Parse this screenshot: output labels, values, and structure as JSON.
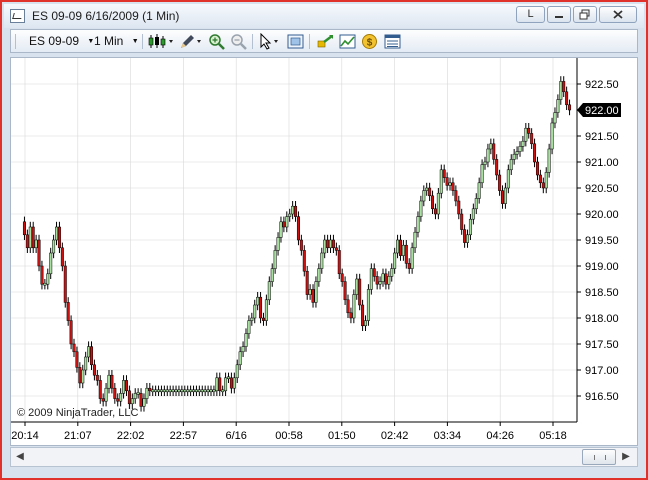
{
  "window": {
    "title": "ES 09-09  6/16/2009 (1 Min)",
    "btn_l": "L"
  },
  "toolbar": {
    "instrument": "ES 09-09",
    "interval": "1 Min",
    "dropdown_glyph": "▼"
  },
  "chart": {
    "copyright": "© 2009 NinjaTrader, LLC",
    "last_price_label": "922.00",
    "colors": {
      "up": "#a8e0a0",
      "down": "#cc1111",
      "wick": "#000000",
      "grid": "#d8d8d8"
    }
  },
  "chart_data": {
    "type": "ohlc-candlestick",
    "instrument": "ES 09-09",
    "interval": "1 Min",
    "ylim": [
      916.25,
      922.75
    ],
    "y_ticks": [
      "922.50",
      "922.00",
      "921.50",
      "921.00",
      "920.50",
      "920.00",
      "919.50",
      "919.00",
      "918.50",
      "918.00",
      "917.50",
      "917.00",
      "916.50"
    ],
    "x_ticks": [
      "20:14",
      "21:07",
      "22:02",
      "22:57",
      "6/16",
      "00:58",
      "01:50",
      "02:42",
      "03:34",
      "04:26",
      "05:18"
    ],
    "last_price": 922.0,
    "closes": [
      919.6,
      919.35,
      919.75,
      919.35,
      919.5,
      919.0,
      918.65,
      918.65,
      918.85,
      919.25,
      919.5,
      919.75,
      919.35,
      919.0,
      918.3,
      917.95,
      917.5,
      917.35,
      917.05,
      916.75,
      917.0,
      917.25,
      917.45,
      917.1,
      916.9,
      916.8,
      916.45,
      916.4,
      916.65,
      916.9,
      916.65,
      916.45,
      916.4,
      916.55,
      916.8,
      916.6,
      916.35,
      916.45,
      916.55,
      916.55,
      916.3,
      916.45,
      916.65,
      916.6,
      916.6,
      916.6,
      916.6,
      916.6,
      916.6,
      916.6,
      916.6,
      916.6,
      916.6,
      916.6,
      916.6,
      916.6,
      916.6,
      916.6,
      916.6,
      916.6,
      916.6,
      916.6,
      916.6,
      916.6,
      916.6,
      916.6,
      916.85,
      916.6,
      916.6,
      916.85,
      916.85,
      916.65,
      916.85,
      917.1,
      917.35,
      917.45,
      917.7,
      917.95,
      918.0,
      918.25,
      918.4,
      918.0,
      917.95,
      918.35,
      918.7,
      918.95,
      919.3,
      919.55,
      919.85,
      919.75,
      919.95,
      920.0,
      920.15,
      919.95,
      919.5,
      919.3,
      918.9,
      918.45,
      918.55,
      918.3,
      918.7,
      918.95,
      919.25,
      919.5,
      919.35,
      919.5,
      919.35,
      919.3,
      918.85,
      918.7,
      918.35,
      918.1,
      918.0,
      918.45,
      918.75,
      918.25,
      917.85,
      917.95,
      918.55,
      918.95,
      918.8,
      918.65,
      918.7,
      918.85,
      918.65,
      918.8,
      918.95,
      919.25,
      919.5,
      919.2,
      919.4,
      919.05,
      918.95,
      919.35,
      919.65,
      919.95,
      920.25,
      920.45,
      920.5,
      920.35,
      920.1,
      920.0,
      920.4,
      920.85,
      920.7,
      920.55,
      920.6,
      920.45,
      920.25,
      920.0,
      919.7,
      919.45,
      919.6,
      919.9,
      920.1,
      920.3,
      920.6,
      920.95,
      921.0,
      921.25,
      921.35,
      921.05,
      920.75,
      920.45,
      920.2,
      920.5,
      920.85,
      921.05,
      921.15,
      921.2,
      921.3,
      921.4,
      921.65,
      921.55,
      921.35,
      921.0,
      920.75,
      920.6,
      920.5,
      920.8,
      921.25,
      921.75,
      921.95,
      922.2,
      922.55,
      922.35,
      922.1,
      922.0
    ]
  }
}
